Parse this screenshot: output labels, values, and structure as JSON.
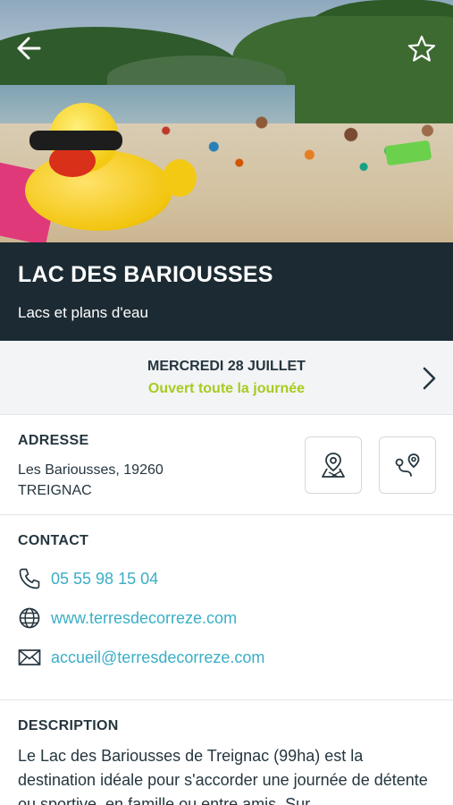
{
  "hero": {
    "back_icon": "arrow-left-icon",
    "favorite_icon": "star-outline-icon"
  },
  "place": {
    "name": "LAC DES BARIOUSSES",
    "category": "Lacs et plans d'eau"
  },
  "hours": {
    "day": "MERCREDI 28 JUILLET",
    "status": "Ouvert toute la journée",
    "status_color": "#a7cb22",
    "next_icon": "chevron-right-icon"
  },
  "address": {
    "title": "ADRESSE",
    "line1": "Les Bariousses, 19260",
    "line2": "TREIGNAC",
    "map_icon": "map-pin-icon",
    "route_icon": "route-icon"
  },
  "contact": {
    "title": "CONTACT",
    "phone": "05 55 98 15 04",
    "website": "www.terresdecorreze.com",
    "email": "accueil@terresdecorreze.com",
    "link_color": "#3aaec6"
  },
  "description": {
    "title": "DESCRIPTION",
    "text": "Le Lac des Bariousses de Treignac (99ha) est la destination idéale pour s'accorder une journée de détente ou sportive, en famille ou entre amis. Sur"
  },
  "colors": {
    "header_bg": "#1c2b33",
    "hours_bg": "#f3f4f5"
  }
}
